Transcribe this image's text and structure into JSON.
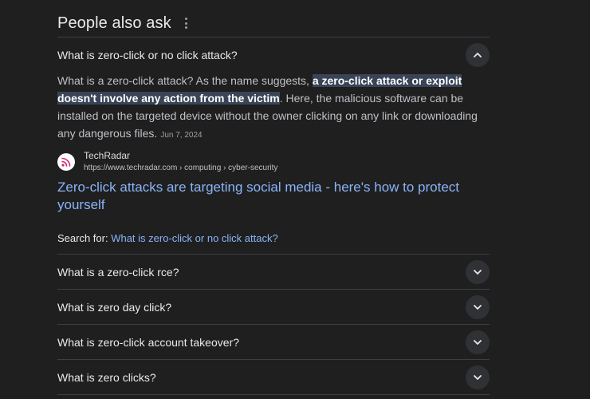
{
  "header": {
    "title": "People also ask"
  },
  "expanded": {
    "question": "What is zero-click or no click attack?",
    "answer_pre": "What is a zero-click attack? As the name suggests, ",
    "answer_highlight": "a zero-click attack or exploit doesn't involve any action from the victim",
    "answer_post": ". Here, the malicious software can be installed on the targeted device without the owner clicking on any link or downloading any dangerous files.",
    "date": "Jun 7, 2024",
    "source_name": "TechRadar",
    "source_url": "https://www.techradar.com › computing › cyber-security",
    "result_title": "Zero-click attacks are targeting social media - here's how to protect yourself",
    "search_for_label": "Search for: ",
    "search_for_query": "What is zero-click or no click attack?"
  },
  "questions": [
    "What is a zero-click rce?",
    "What is zero day click?",
    "What is zero-click account takeover?",
    "What is zero clicks?"
  ],
  "icons": {
    "menu": "kebab-icon",
    "collapse": "chevron-up-icon",
    "expand": "chevron-down-icon",
    "favicon": "techradar-logo"
  },
  "colors": {
    "background": "#1f1f1f",
    "link": "#8ab4f8",
    "highlight": "#394457",
    "favicon": "#d6257a"
  }
}
